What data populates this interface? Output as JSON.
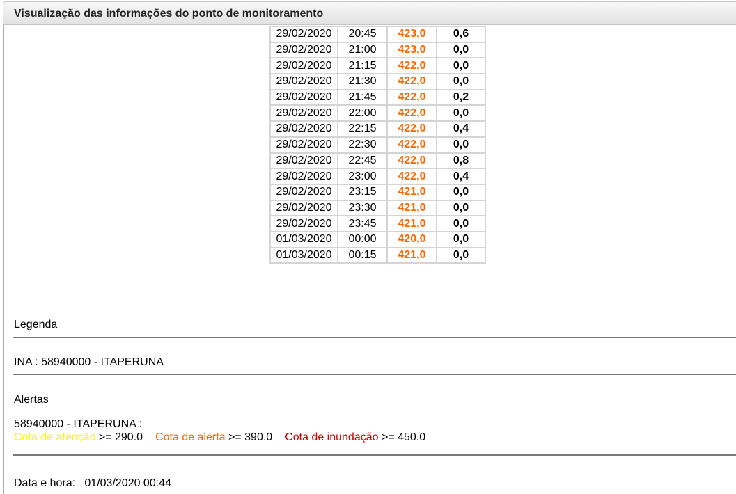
{
  "header": {
    "title": "Visualização das informações do ponto de monitoramento"
  },
  "rows": [
    {
      "date": "29/02/2020",
      "time": "20:45",
      "level": "423,0",
      "rain": "0,6"
    },
    {
      "date": "29/02/2020",
      "time": "21:00",
      "level": "423,0",
      "rain": "0,0"
    },
    {
      "date": "29/02/2020",
      "time": "21:15",
      "level": "422,0",
      "rain": "0,0"
    },
    {
      "date": "29/02/2020",
      "time": "21:30",
      "level": "422,0",
      "rain": "0,0"
    },
    {
      "date": "29/02/2020",
      "time": "21:45",
      "level": "422,0",
      "rain": "0,2"
    },
    {
      "date": "29/02/2020",
      "time": "22:00",
      "level": "422,0",
      "rain": "0,0"
    },
    {
      "date": "29/02/2020",
      "time": "22:15",
      "level": "422,0",
      "rain": "0,4"
    },
    {
      "date": "29/02/2020",
      "time": "22:30",
      "level": "422,0",
      "rain": "0,0"
    },
    {
      "date": "29/02/2020",
      "time": "22:45",
      "level": "422,0",
      "rain": "0,8"
    },
    {
      "date": "29/02/2020",
      "time": "23:00",
      "level": "422,0",
      "rain": "0,4"
    },
    {
      "date": "29/02/2020",
      "time": "23:15",
      "level": "421,0",
      "rain": "0,0"
    },
    {
      "date": "29/02/2020",
      "time": "23:30",
      "level": "421,0",
      "rain": "0,0"
    },
    {
      "date": "29/02/2020",
      "time": "23:45",
      "level": "421,0",
      "rain": "0,0"
    },
    {
      "date": "01/03/2020",
      "time": "00:00",
      "level": "420,0",
      "rain": "0,0"
    },
    {
      "date": "01/03/2020",
      "time": "00:15",
      "level": "421,0",
      "rain": "0,0"
    }
  ],
  "legend": {
    "heading": "Legenda",
    "ina": "INA : 58940000 - ITAPERUNA"
  },
  "alerts": {
    "heading": "Alertas",
    "station": "58940000 - ITAPERUNA :",
    "attention_label": "Cota de atenção",
    "attention_value": ">= 290.0",
    "alert_label": "Cota de alerta",
    "alert_value": ">= 390.0",
    "flood_label": "Cota de inundação",
    "flood_value": ">= 450.0"
  },
  "footer": {
    "datetime_label": "Data e hora:",
    "datetime_value": "01/03/2020 00:44"
  },
  "colors": {
    "level_text": "#ff6600",
    "attention": "#ffff00",
    "alert": "#ff6600",
    "flood": "#cc0000"
  }
}
